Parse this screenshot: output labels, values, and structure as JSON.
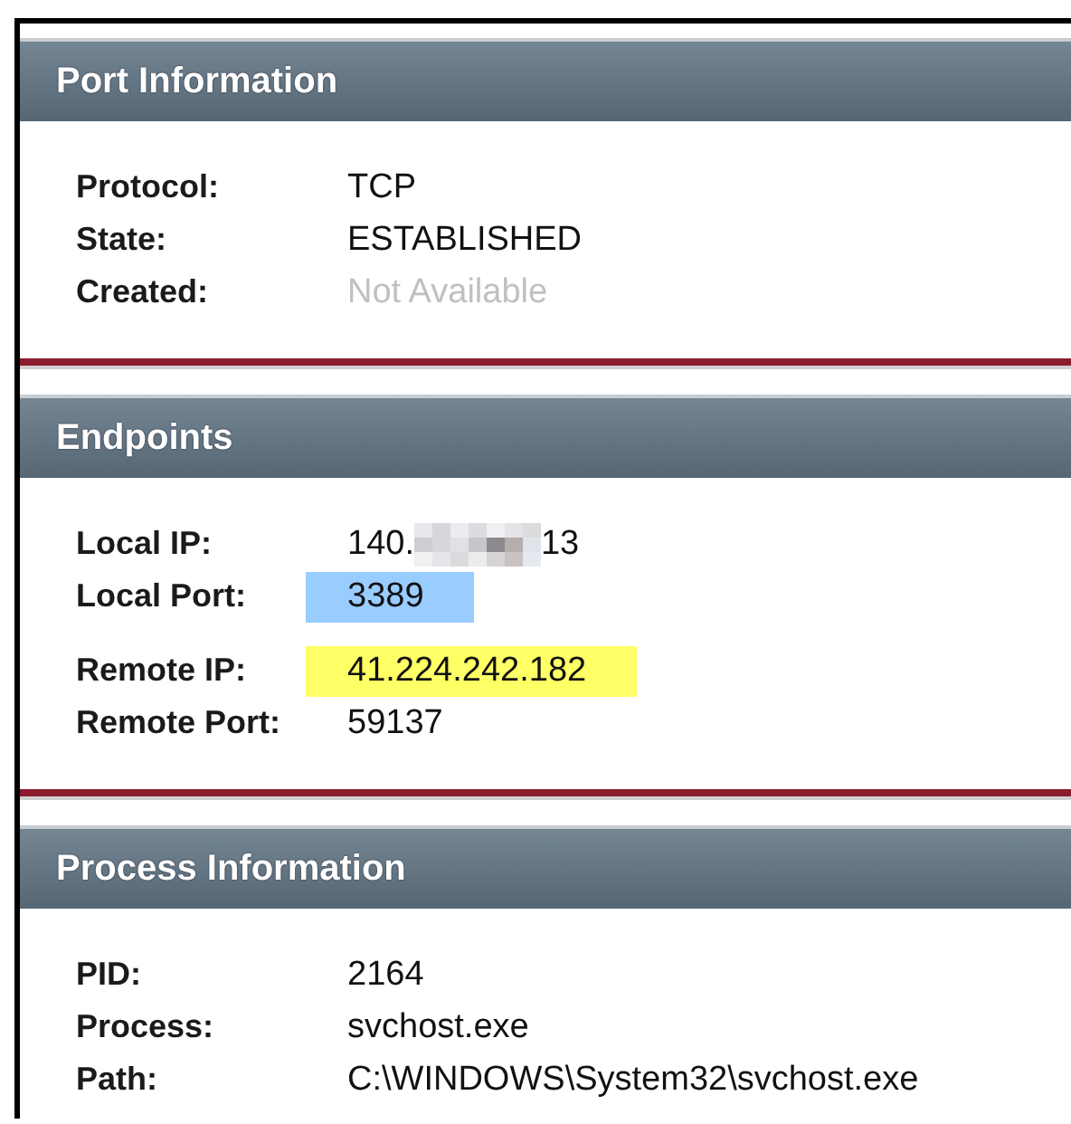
{
  "sections": [
    {
      "title": "Port Information",
      "groups": [
        [
          {
            "label": "Protocol:",
            "value": "TCP",
            "muted": false
          },
          {
            "label": "State:",
            "value": "ESTABLISHED",
            "muted": false
          },
          {
            "label": "Created:",
            "value": "Not Available",
            "muted": true
          }
        ]
      ]
    },
    {
      "title": "Endpoints",
      "groups": [
        [
          {
            "label": "Local IP:",
            "value": "140.",
            "value_end": "13",
            "redacted": true,
            "muted": false
          },
          {
            "label": "Local Port:",
            "value": "3389",
            "color": "#99ccff",
            "muted": false
          }
        ],
        [
          {
            "label": "Remote IP:",
            "value": "41.224.242.182",
            "color": "#ffff66",
            "muted": false
          },
          {
            "label": "Remote Port:",
            "value": "59137",
            "muted": false
          }
        ]
      ]
    },
    {
      "title": "Process Information",
      "groups": [
        [
          {
            "label": "PID:",
            "value": "2164",
            "muted": false
          },
          {
            "label": "Process:",
            "value": "svchost.exe",
            "muted": false
          },
          {
            "label": "Path:",
            "value": "C:\\WINDOWS\\System32\\svchost.exe",
            "muted": false
          }
        ]
      ]
    }
  ]
}
